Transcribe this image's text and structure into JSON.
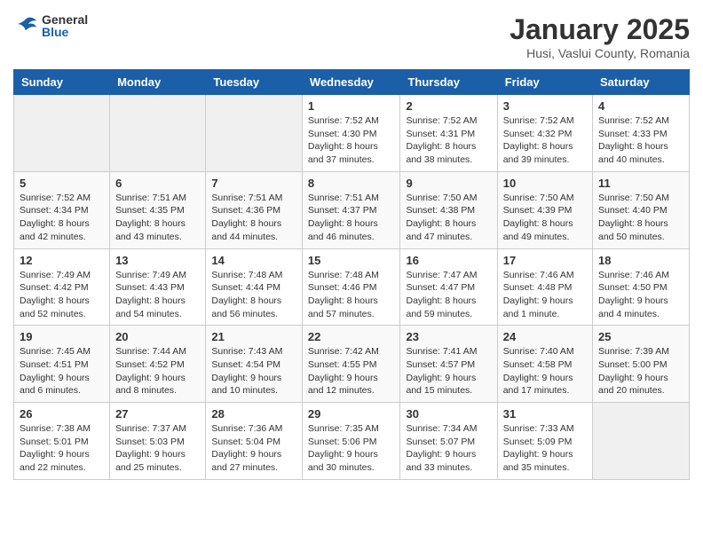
{
  "header": {
    "logo_general": "General",
    "logo_blue": "Blue",
    "month_title": "January 2025",
    "location": "Husi, Vaslui County, Romania"
  },
  "days_of_week": [
    "Sunday",
    "Monday",
    "Tuesday",
    "Wednesday",
    "Thursday",
    "Friday",
    "Saturday"
  ],
  "weeks": [
    [
      {
        "day": "",
        "info": ""
      },
      {
        "day": "",
        "info": ""
      },
      {
        "day": "",
        "info": ""
      },
      {
        "day": "1",
        "info": "Sunrise: 7:52 AM\nSunset: 4:30 PM\nDaylight: 8 hours and 37 minutes."
      },
      {
        "day": "2",
        "info": "Sunrise: 7:52 AM\nSunset: 4:31 PM\nDaylight: 8 hours and 38 minutes."
      },
      {
        "day": "3",
        "info": "Sunrise: 7:52 AM\nSunset: 4:32 PM\nDaylight: 8 hours and 39 minutes."
      },
      {
        "day": "4",
        "info": "Sunrise: 7:52 AM\nSunset: 4:33 PM\nDaylight: 8 hours and 40 minutes."
      }
    ],
    [
      {
        "day": "5",
        "info": "Sunrise: 7:52 AM\nSunset: 4:34 PM\nDaylight: 8 hours and 42 minutes."
      },
      {
        "day": "6",
        "info": "Sunrise: 7:51 AM\nSunset: 4:35 PM\nDaylight: 8 hours and 43 minutes."
      },
      {
        "day": "7",
        "info": "Sunrise: 7:51 AM\nSunset: 4:36 PM\nDaylight: 8 hours and 44 minutes."
      },
      {
        "day": "8",
        "info": "Sunrise: 7:51 AM\nSunset: 4:37 PM\nDaylight: 8 hours and 46 minutes."
      },
      {
        "day": "9",
        "info": "Sunrise: 7:50 AM\nSunset: 4:38 PM\nDaylight: 8 hours and 47 minutes."
      },
      {
        "day": "10",
        "info": "Sunrise: 7:50 AM\nSunset: 4:39 PM\nDaylight: 8 hours and 49 minutes."
      },
      {
        "day": "11",
        "info": "Sunrise: 7:50 AM\nSunset: 4:40 PM\nDaylight: 8 hours and 50 minutes."
      }
    ],
    [
      {
        "day": "12",
        "info": "Sunrise: 7:49 AM\nSunset: 4:42 PM\nDaylight: 8 hours and 52 minutes."
      },
      {
        "day": "13",
        "info": "Sunrise: 7:49 AM\nSunset: 4:43 PM\nDaylight: 8 hours and 54 minutes."
      },
      {
        "day": "14",
        "info": "Sunrise: 7:48 AM\nSunset: 4:44 PM\nDaylight: 8 hours and 56 minutes."
      },
      {
        "day": "15",
        "info": "Sunrise: 7:48 AM\nSunset: 4:46 PM\nDaylight: 8 hours and 57 minutes."
      },
      {
        "day": "16",
        "info": "Sunrise: 7:47 AM\nSunset: 4:47 PM\nDaylight: 8 hours and 59 minutes."
      },
      {
        "day": "17",
        "info": "Sunrise: 7:46 AM\nSunset: 4:48 PM\nDaylight: 9 hours and 1 minute."
      },
      {
        "day": "18",
        "info": "Sunrise: 7:46 AM\nSunset: 4:50 PM\nDaylight: 9 hours and 4 minutes."
      }
    ],
    [
      {
        "day": "19",
        "info": "Sunrise: 7:45 AM\nSunset: 4:51 PM\nDaylight: 9 hours and 6 minutes."
      },
      {
        "day": "20",
        "info": "Sunrise: 7:44 AM\nSunset: 4:52 PM\nDaylight: 9 hours and 8 minutes."
      },
      {
        "day": "21",
        "info": "Sunrise: 7:43 AM\nSunset: 4:54 PM\nDaylight: 9 hours and 10 minutes."
      },
      {
        "day": "22",
        "info": "Sunrise: 7:42 AM\nSunset: 4:55 PM\nDaylight: 9 hours and 12 minutes."
      },
      {
        "day": "23",
        "info": "Sunrise: 7:41 AM\nSunset: 4:57 PM\nDaylight: 9 hours and 15 minutes."
      },
      {
        "day": "24",
        "info": "Sunrise: 7:40 AM\nSunset: 4:58 PM\nDaylight: 9 hours and 17 minutes."
      },
      {
        "day": "25",
        "info": "Sunrise: 7:39 AM\nSunset: 5:00 PM\nDaylight: 9 hours and 20 minutes."
      }
    ],
    [
      {
        "day": "26",
        "info": "Sunrise: 7:38 AM\nSunset: 5:01 PM\nDaylight: 9 hours and 22 minutes."
      },
      {
        "day": "27",
        "info": "Sunrise: 7:37 AM\nSunset: 5:03 PM\nDaylight: 9 hours and 25 minutes."
      },
      {
        "day": "28",
        "info": "Sunrise: 7:36 AM\nSunset: 5:04 PM\nDaylight: 9 hours and 27 minutes."
      },
      {
        "day": "29",
        "info": "Sunrise: 7:35 AM\nSunset: 5:06 PM\nDaylight: 9 hours and 30 minutes."
      },
      {
        "day": "30",
        "info": "Sunrise: 7:34 AM\nSunset: 5:07 PM\nDaylight: 9 hours and 33 minutes."
      },
      {
        "day": "31",
        "info": "Sunrise: 7:33 AM\nSunset: 5:09 PM\nDaylight: 9 hours and 35 minutes."
      },
      {
        "day": "",
        "info": ""
      }
    ]
  ]
}
